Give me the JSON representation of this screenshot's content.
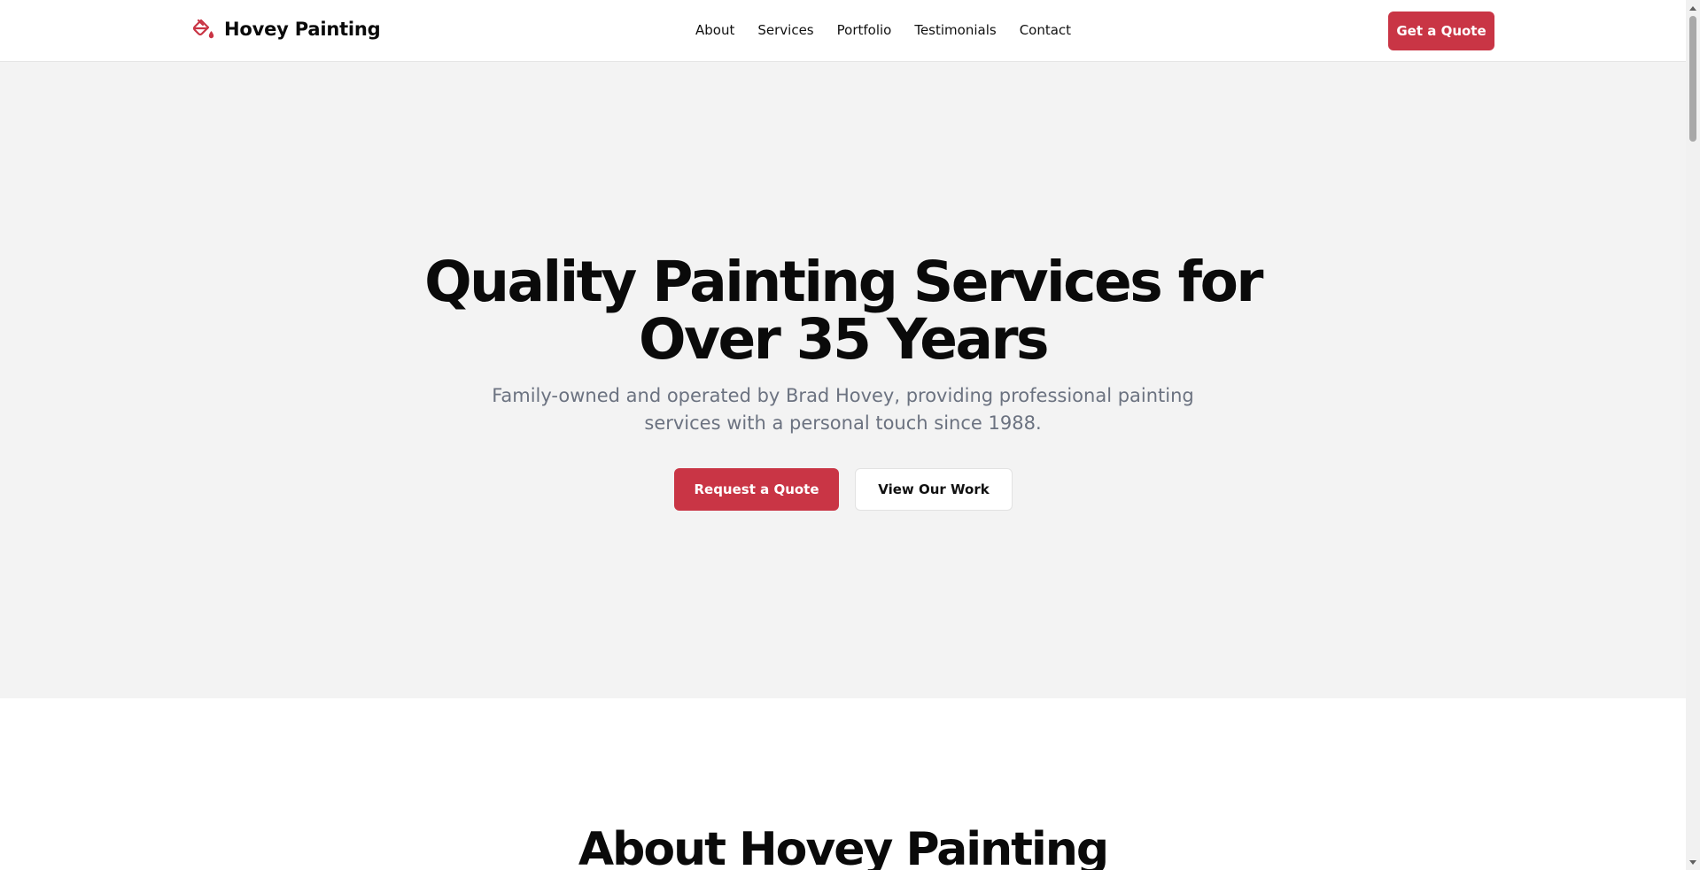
{
  "brand": {
    "name": "Hovey Painting",
    "icon": "paint-bucket-icon",
    "accent_color": "#c93545"
  },
  "nav": {
    "items": [
      {
        "label": "About"
      },
      {
        "label": "Services"
      },
      {
        "label": "Portfolio"
      },
      {
        "label": "Testimonials"
      },
      {
        "label": "Contact"
      }
    ]
  },
  "header": {
    "cta_label": "Get a Quote"
  },
  "hero": {
    "title_line1": "Quality Painting Services for",
    "title_line2": "Over 35 Years",
    "subtitle": "Family-owned and operated by Brad Hovey, providing professional painting services with a personal touch since 1988.",
    "primary_button": "Request a Quote",
    "secondary_button": "View Our Work",
    "background_color": "#f3f3f3"
  },
  "about": {
    "heading": "About Hovey Painting"
  }
}
